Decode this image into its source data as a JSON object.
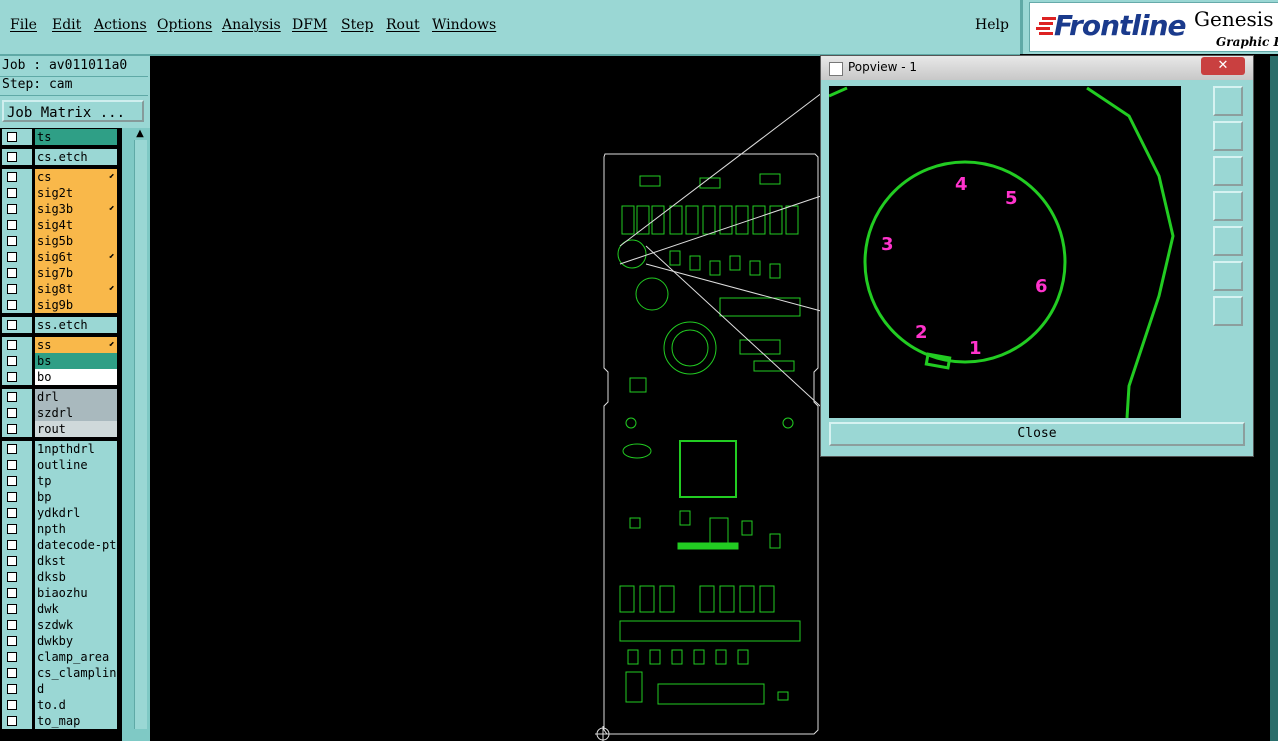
{
  "menubar": {
    "items": [
      "File",
      "Edit",
      "Actions",
      "Options",
      "Analysis",
      "DFM",
      "Step",
      "Rout",
      "Windows"
    ],
    "help": "Help"
  },
  "logo": {
    "brand": "Frontline",
    "product": "Genesis",
    "tagline": "Graphic Ed"
  },
  "job": {
    "job_line": "Job : av011011a0",
    "step_line": "Step: cam",
    "matrix_button": "Job Matrix ..."
  },
  "layers": [
    {
      "name": "ts",
      "color": "#2f9f86",
      "group": 0,
      "mark": ""
    },
    {
      "name": "cs.etch",
      "color": "#9ad7d4",
      "group": 1,
      "mark": ""
    },
    {
      "name": "cs",
      "color": "#f9b84a",
      "group": 2,
      "mark": "⬋"
    },
    {
      "name": "sig2t",
      "color": "#f9b84a",
      "group": 2,
      "mark": ""
    },
    {
      "name": "sig3b",
      "color": "#f9b84a",
      "group": 2,
      "mark": "⬋"
    },
    {
      "name": "sig4t",
      "color": "#f9b84a",
      "group": 2,
      "mark": ""
    },
    {
      "name": "sig5b",
      "color": "#f9b84a",
      "group": 2,
      "mark": ""
    },
    {
      "name": "sig6t",
      "color": "#f9b84a",
      "group": 2,
      "mark": "⬋"
    },
    {
      "name": "sig7b",
      "color": "#f9b84a",
      "group": 2,
      "mark": ""
    },
    {
      "name": "sig8t",
      "color": "#f9b84a",
      "group": 2,
      "mark": "⬋"
    },
    {
      "name": "sig9b",
      "color": "#f9b84a",
      "group": 2,
      "mark": ""
    },
    {
      "name": "ss.etch",
      "color": "#9ad7d4",
      "group": 3,
      "mark": ""
    },
    {
      "name": "ss",
      "color": "#f9b84a",
      "group": 4,
      "mark": "⬋"
    },
    {
      "name": "bs",
      "color": "#2f9f86",
      "group": 4,
      "mark": ""
    },
    {
      "name": "bo",
      "color": "#ffffff",
      "group": 4,
      "mark": ""
    },
    {
      "name": "drl",
      "color": "#a9b9be",
      "group": 5,
      "mark": ""
    },
    {
      "name": "szdrl",
      "color": "#a9b9be",
      "group": 5,
      "mark": ""
    },
    {
      "name": "rout",
      "color": "#cfd9da",
      "group": 5,
      "mark": ""
    },
    {
      "name": "1npthdrl",
      "color": "#9ad7d4",
      "group": 6,
      "mark": ""
    },
    {
      "name": "outline",
      "color": "#9ad7d4",
      "group": 6,
      "mark": ""
    },
    {
      "name": "tp",
      "color": "#9ad7d4",
      "group": 6,
      "mark": ""
    },
    {
      "name": "bp",
      "color": "#9ad7d4",
      "group": 6,
      "mark": ""
    },
    {
      "name": "ydkdrl",
      "color": "#9ad7d4",
      "group": 6,
      "mark": ""
    },
    {
      "name": "npth",
      "color": "#9ad7d4",
      "group": 6,
      "mark": ""
    },
    {
      "name": "datecode-pts",
      "color": "#9ad7d4",
      "group": 6,
      "mark": ""
    },
    {
      "name": "dkst",
      "color": "#9ad7d4",
      "group": 6,
      "mark": ""
    },
    {
      "name": "dksb",
      "color": "#9ad7d4",
      "group": 6,
      "mark": ""
    },
    {
      "name": "biaozhu",
      "color": "#9ad7d4",
      "group": 6,
      "mark": ""
    },
    {
      "name": "dwk",
      "color": "#9ad7d4",
      "group": 6,
      "mark": ""
    },
    {
      "name": "szdwk",
      "color": "#9ad7d4",
      "group": 6,
      "mark": ""
    },
    {
      "name": "dwkby",
      "color": "#9ad7d4",
      "group": 6,
      "mark": ""
    },
    {
      "name": "clamp_area",
      "color": "#9ad7d4",
      "group": 6,
      "mark": ""
    },
    {
      "name": "cs_clampline",
      "color": "#9ad7d4",
      "group": 6,
      "mark": ""
    },
    {
      "name": "d",
      "color": "#9ad7d4",
      "group": 6,
      "mark": ""
    },
    {
      "name": "to.d",
      "color": "#9ad7d4",
      "group": 6,
      "mark": ""
    },
    {
      "name": "to_map",
      "color": "#9ad7d4",
      "group": 6,
      "mark": ""
    }
  ],
  "popview": {
    "title": "Popview - 1",
    "close_x": "✕",
    "close_button": "Close",
    "pin_labels": [
      "1",
      "2",
      "3",
      "4",
      "5",
      "6"
    ],
    "tools": [
      "zoom-fit-icon",
      "move-up-icon",
      "move-down-icon",
      "move-left-icon",
      "move-right-icon",
      "zoom-out-icon",
      "pan-icon"
    ]
  },
  "colors": {
    "panel": "#9ad7d4",
    "pcb_green": "#22cc22",
    "pin_label": "#ff33cc",
    "background": "#000000"
  }
}
